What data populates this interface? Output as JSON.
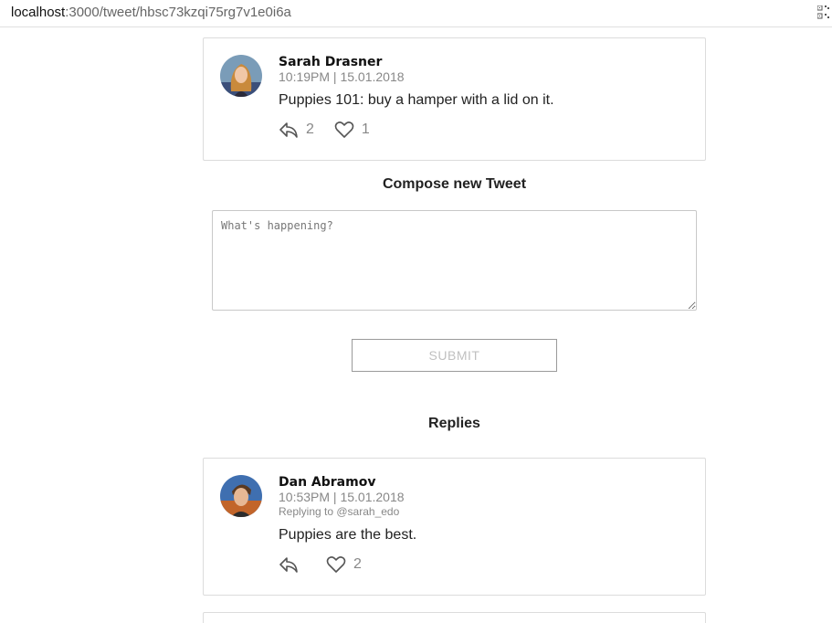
{
  "browser": {
    "url_host": "localhost",
    "url_path": ":3000/tweet/hbsc73kzqi75rg7v1e0i6a",
    "qr_icon": "qr-code-icon"
  },
  "main_tweet": {
    "author": "Sarah Drasner",
    "meta": "10:19PM | 15.01.2018",
    "text": "Puppies 101: buy a hamper with a lid on it.",
    "reply_count": "2",
    "like_count": "1",
    "icons": {
      "reply": "reply-icon",
      "like": "heart-icon"
    }
  },
  "compose": {
    "title": "Compose new Tweet",
    "placeholder": "What's happening?",
    "value": "",
    "submit_label": "SUBMIT"
  },
  "replies": {
    "title": "Replies",
    "items": [
      {
        "author": "Dan Abramov",
        "meta": "10:53PM | 15.01.2018",
        "replying_to": "Replying to @sarah_edo",
        "text": "Puppies are the best.",
        "reply_count": "",
        "like_count": "2"
      }
    ]
  },
  "colors": {
    "border": "#dcdcdc",
    "muted_text": "#888888",
    "primary_text": "#222222"
  }
}
